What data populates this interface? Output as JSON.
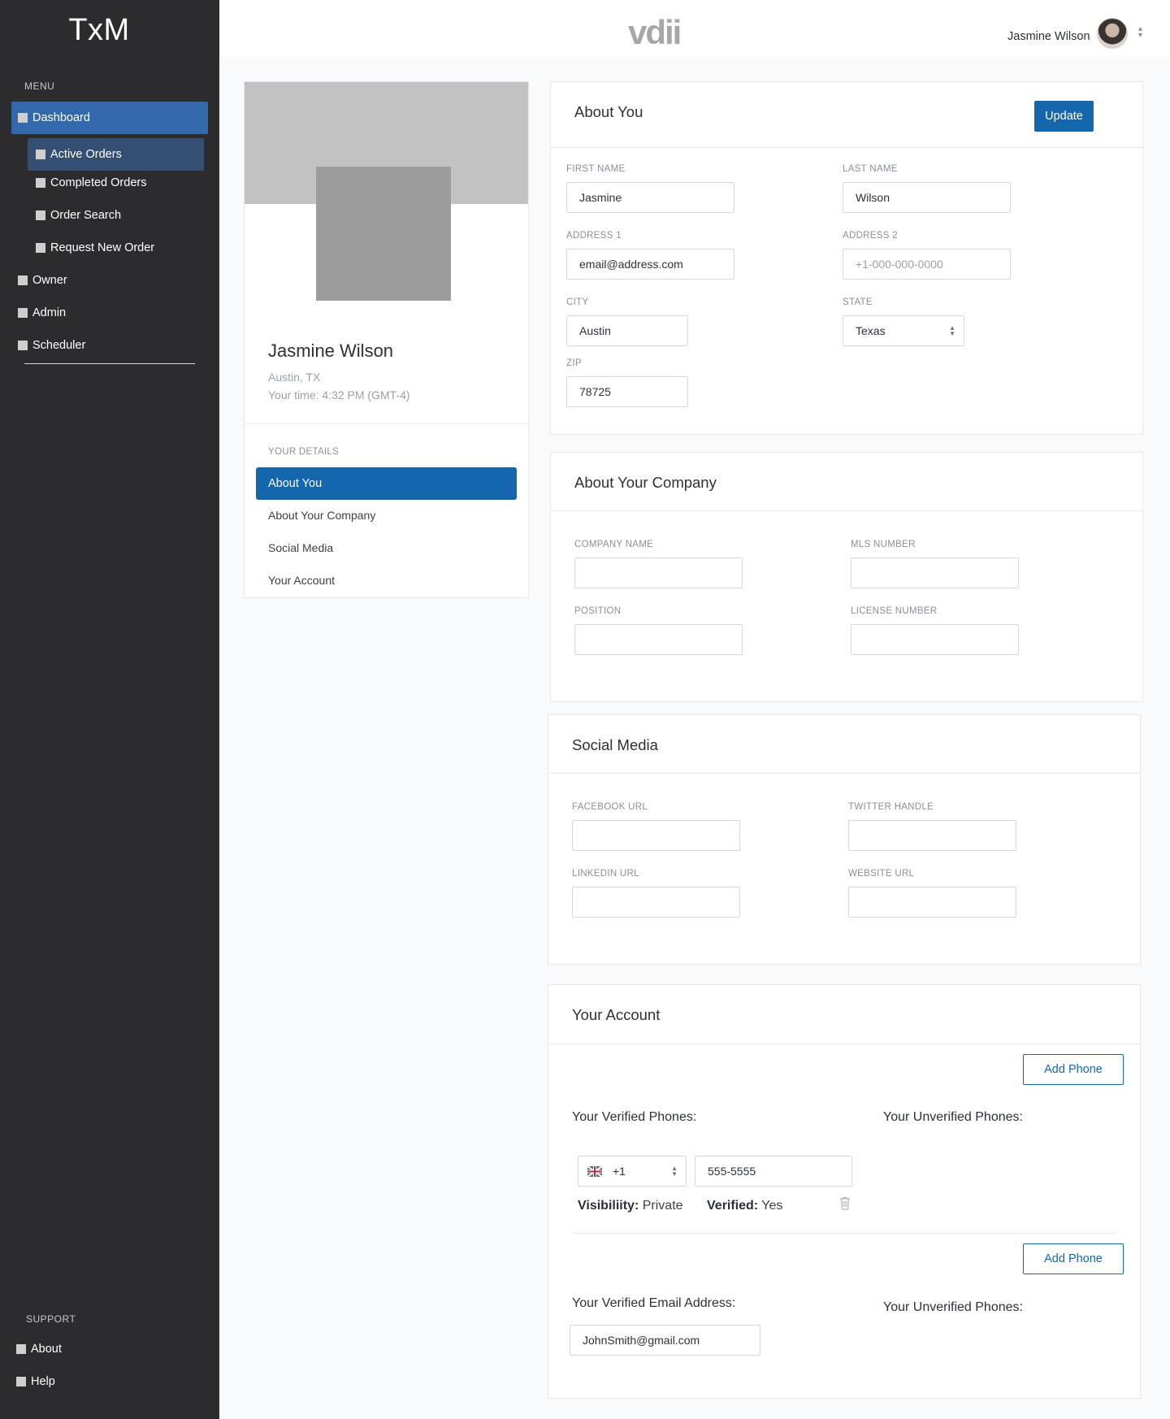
{
  "sidebar": {
    "brand": "TxM",
    "menu_title": "MENU",
    "items": [
      {
        "label": "Dashboard"
      },
      {
        "label": "Active Orders"
      },
      {
        "label": "Completed Orders"
      },
      {
        "label": "Order Search"
      },
      {
        "label": "Request New Order"
      },
      {
        "label": "Owner"
      },
      {
        "label": "Admin"
      },
      {
        "label": "Scheduler"
      }
    ],
    "support_title": "SUPPORT",
    "support_items": [
      {
        "label": "About"
      },
      {
        "label": "Help"
      }
    ]
  },
  "header": {
    "logo_text": "vdii",
    "user_name": "Jasmine Wilson"
  },
  "profile": {
    "name": "Jasmine Wilson",
    "location": "Austin, TX",
    "time": "Your time: 4:32 PM (GMT-4)",
    "section_title": "YOUR DETAILS",
    "nav": [
      {
        "label": "About You"
      },
      {
        "label": "About Your Company"
      },
      {
        "label": "Social Media"
      },
      {
        "label": "Your Account"
      }
    ]
  },
  "about_you": {
    "title": "About You",
    "update_label": "Update",
    "first_name_label": "FIRST NAME",
    "first_name": "Jasmine",
    "last_name_label": "LAST NAME",
    "last_name": "Wilson",
    "address1_label": "ADDRESS 1",
    "address1": "email@address.com",
    "address2_label": "ADDRESS 2",
    "address2_placeholder": "+1-000-000-0000",
    "city_label": "CITY",
    "city": "Austin",
    "state_label": "STATE",
    "state": "Texas",
    "zip_label": "ZIP",
    "zip": "78725"
  },
  "company": {
    "title": "About Your Company",
    "company_name_label": "COMPANY NAME",
    "mls_label": "MLS NUMBER",
    "position_label": "POSITION",
    "license_label": "LICENSE NUMBER"
  },
  "social": {
    "title": "Social Media",
    "facebook_label": "FACEBOOK URL",
    "twitter_label": "TWITTER HANDLE",
    "linkedin_label": "LINKEDIN URL",
    "website_label": "WEBSITE URL"
  },
  "account": {
    "title": "Your Account",
    "add_phone_label": "Add Phone",
    "verified_phones_label": "Your Verified Phones:",
    "unverified_phones_label": "Your Unverified Phones:",
    "country_code": "+1",
    "phone_number": "555-5555",
    "visibility_label": "Visibiliity:",
    "visibility_value": "Private",
    "verified_label": "Verified:",
    "verified_value": "Yes",
    "add_phone_label_2": "Add Phone",
    "verified_email_label": "Your Verified Email Address:",
    "unverified_phones_label_2": "Your Unverified Phones:",
    "email": "JohnSmith@gmail.com"
  },
  "colors": {
    "sidebar_bg": "#2c2c2e",
    "accent": "#1466ad",
    "active_nav": "#3269ab",
    "active_subnav": "#354f73"
  }
}
